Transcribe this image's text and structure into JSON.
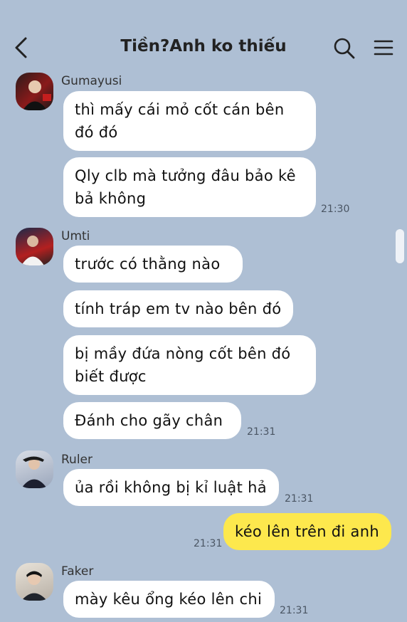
{
  "header": {
    "title": "Tiền?Anh ko thiếu",
    "back_icon": "chevron-left-icon",
    "search_icon": "search-icon",
    "menu_icon": "hamburger-menu-icon"
  },
  "messages": [
    {
      "sender": "Gumayusi",
      "bubbles": [
        "thì mấy cái mỏ cốt cán bên đó đó",
        "Qly clb mà tưởng đâu bảo kê bả không"
      ],
      "time": "21:30"
    },
    {
      "sender": "Umti",
      "bubbles": [
        "trước có thằng nào",
        "tính tráp em tv nào bên đó",
        "bị mầy đứa nòng cốt bên đó biết được",
        "Đánh cho gãy chân"
      ],
      "time": "21:31"
    },
    {
      "sender": "Ruler",
      "bubbles": [
        "ủa rồi không bị kỉ luật hả"
      ],
      "time": "21:31"
    },
    {
      "sender": "me",
      "bubbles": [
        "kéo lên trên đi anh"
      ],
      "time": "21:31"
    },
    {
      "sender": "Faker",
      "bubbles": [
        "mày kêu ổng kéo lên chi"
      ],
      "time": "21:31"
    }
  ],
  "colors": {
    "background": "#aebfd4",
    "my_bubble": "#fde84d",
    "other_bubble": "#ffffff"
  }
}
